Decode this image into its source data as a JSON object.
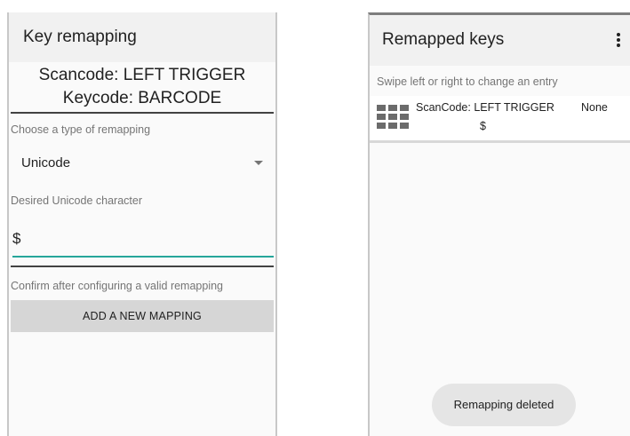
{
  "left_screen": {
    "title": "Key remapping",
    "scancode_line": "Scancode: LEFT TRIGGER",
    "keycode_line": "Keycode: BARCODE",
    "type_hint": "Choose a type of remapping",
    "type_value": "Unicode",
    "char_hint": "Desired Unicode character",
    "char_value": "$",
    "confirm_hint": "Confirm after configuring a valid remapping",
    "add_button": "ADD A NEW MAPPING"
  },
  "right_screen": {
    "title": "Remapped keys",
    "menu_icon": "more-vert-icon",
    "swipe_hint": "Swipe left or right to change an entry",
    "entries": [
      {
        "icon": "keypad-grid-icon",
        "scancode": "ScanCode: LEFT TRIGGER",
        "mapped": "$",
        "keycode": "None"
      }
    ],
    "toast": "Remapping deleted"
  },
  "colors": {
    "accent": "#26a69a",
    "appbar": "#f1f1f1",
    "button": "#d6d6d6",
    "toast": "#e5e5e5"
  }
}
